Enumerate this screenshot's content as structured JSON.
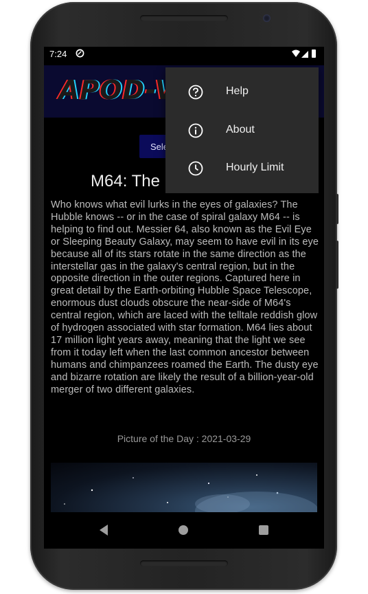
{
  "status_bar": {
    "time": "7:24"
  },
  "banner": {
    "title": "APOD-V"
  },
  "select_button": {
    "label": "Sele"
  },
  "article": {
    "title": "M64: The",
    "explanation": "Who knows what evil lurks in the eyes of galaxies? The Hubble knows -- or in the case of spiral galaxy M64 -- is helping to find out. Messier 64, also known as the Evil Eye or Sleeping Beauty Galaxy, may seem to have evil in its eye because all of its stars rotate in the same direction as the interstellar gas in the galaxy's central region, but in the opposite direction in the outer regions. Captured here in great detail by the Earth-orbiting Hubble Space Telescope, enormous dust clouds obscure the near-side of M64's central region, which are laced with the telltale reddish glow of hydrogen associated with star formation.  M64 lies about 17 million light years away, meaning that the light we see from it today left when the last common ancestor between humans and chimpanzees roamed the Earth.  The dusty eye and bizarre rotation are likely the result of a billion-year-old merger of two different galaxies.",
    "date": "Picture of the Day : 2021-03-29"
  },
  "overflow_menu": {
    "items": [
      {
        "label": "Help",
        "icon": "help-circle-icon"
      },
      {
        "label": "About",
        "icon": "info-circle-icon"
      },
      {
        "label": "Hourly Limit",
        "icon": "clock-icon"
      }
    ]
  },
  "nav_bar": {
    "icons": [
      "back-icon",
      "home-icon",
      "recents-icon"
    ]
  },
  "colors": {
    "banner_bg": "#0a0a30",
    "button_bg": "#0b0b5a",
    "menu_bg": "#2b2b2b",
    "screen_bg": "#000000"
  }
}
